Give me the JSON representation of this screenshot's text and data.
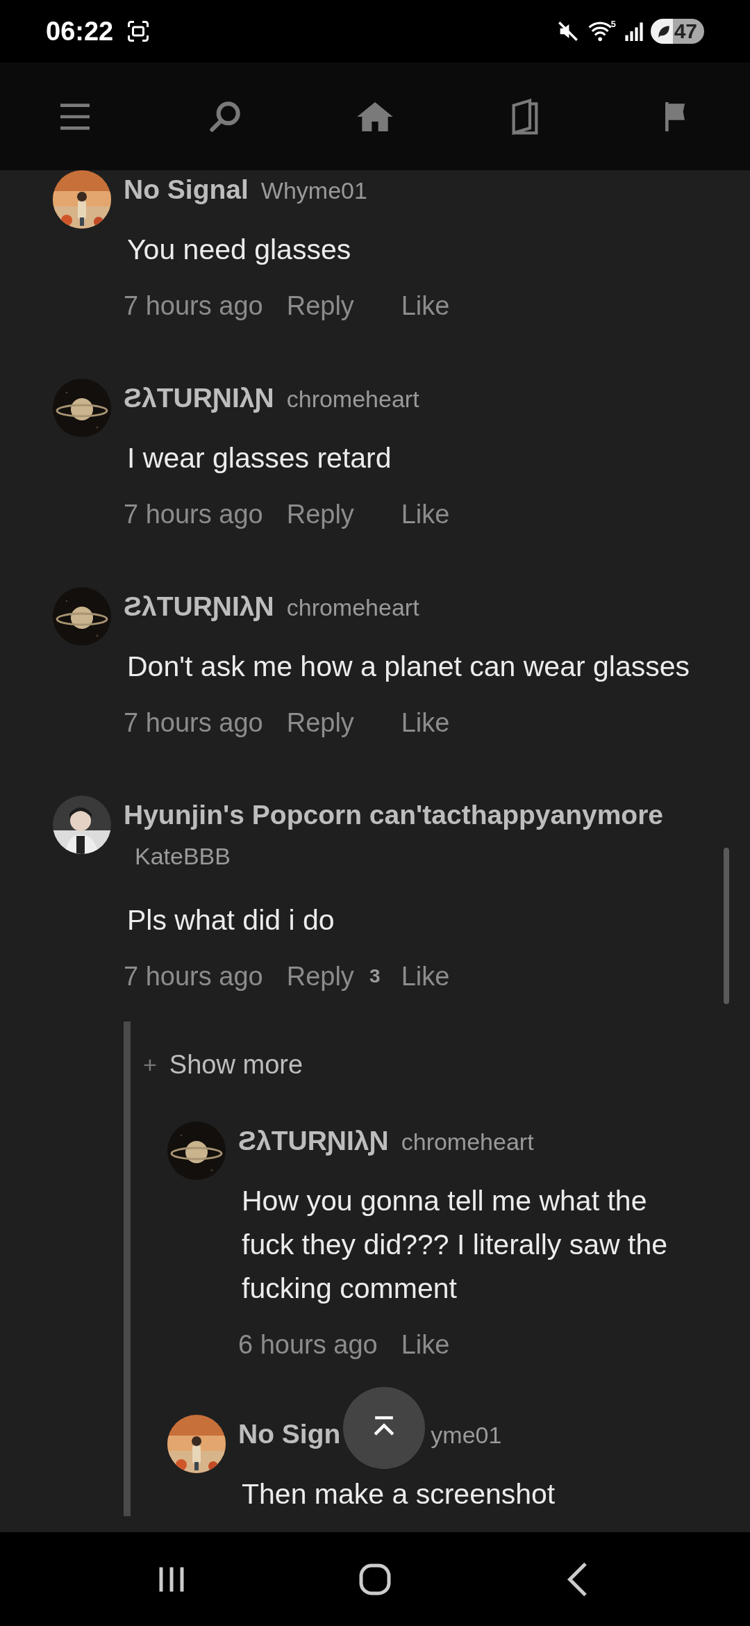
{
  "status_bar": {
    "time": "06:22",
    "wifi_label": "5",
    "battery": "47"
  },
  "comments": [
    {
      "name": "No Signal",
      "handle": "Whyme01",
      "body": "You need glasses",
      "time": "7 hours ago",
      "reply": "Reply",
      "like": "Like"
    },
    {
      "name": "ƧλTURƝIλƝ",
      "handle": "chromeheart",
      "body": "I wear glasses retard",
      "time": "7 hours ago",
      "reply": "Reply",
      "like": "Like"
    },
    {
      "name": "ƧλTURƝIλƝ",
      "handle": "chromeheart",
      "body": "Don't ask me how a planet can wear glasses",
      "time": "7 hours ago",
      "reply": "Reply",
      "like": "Like"
    },
    {
      "name": "Hyunjin's Popcorn can'tacthappyanymore",
      "handle": "KateBBB",
      "body": "Pls what did i do",
      "time": "7 hours ago",
      "reply": "Reply",
      "reply_count": "3",
      "like": "Like",
      "thread": {
        "show_more_icon": "+",
        "show_more": "Show more",
        "replies": [
          {
            "name": "ƧλTURƝIλƝ",
            "handle": "chromeheart",
            "body": "How you gonna tell me what the fuck they did??? I literally saw the fucking comment",
            "time": "6 hours ago",
            "like": "Like"
          },
          {
            "name": "No Sign",
            "handle": "yme01",
            "body": "Then make a screenshot"
          }
        ]
      }
    }
  ]
}
